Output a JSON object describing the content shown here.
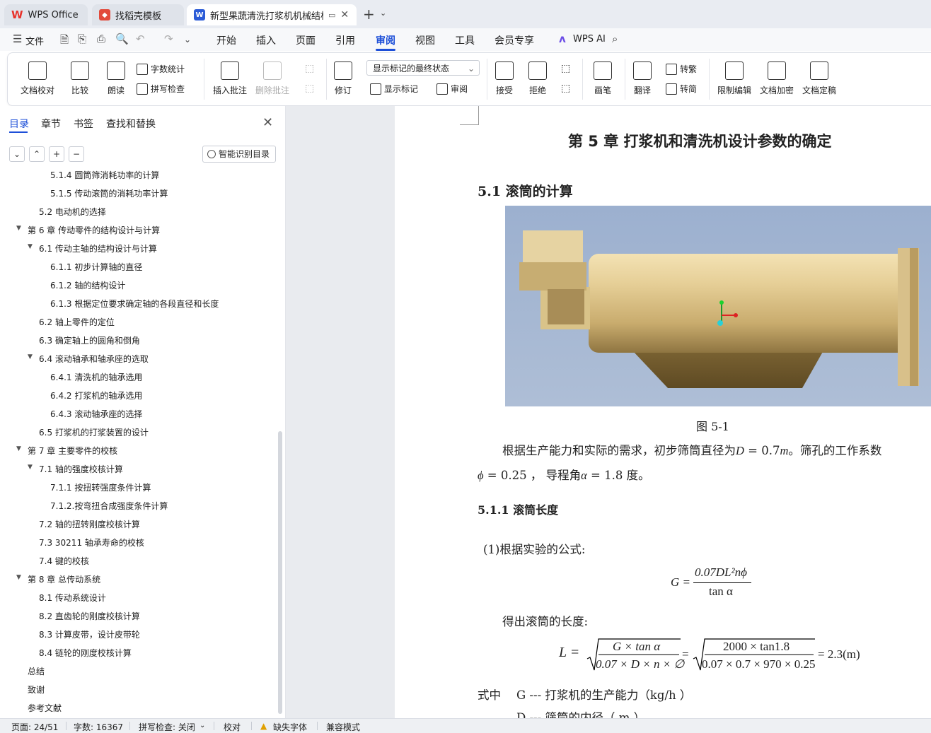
{
  "tabs": [
    {
      "label": "WPS Office",
      "logo": "W"
    },
    {
      "label": "找稻壳模板",
      "logo": "D"
    },
    {
      "label": "新型果蔬清洗打浆机机械结构设",
      "logo": "W"
    }
  ],
  "menu": {
    "file": "文件",
    "items": [
      "开始",
      "插入",
      "页面",
      "引用",
      "审阅",
      "视图",
      "工具",
      "会员专享"
    ],
    "selected": "审阅",
    "wps_ai": "WPS AI"
  },
  "ribbon": {
    "doc_check": "文档校对",
    "compare": "比较",
    "read_aloud": "朗读",
    "word_count": "字数统计",
    "spell_check": "拼写检查",
    "insert_comment": "插入批注",
    "delete_comment": "删除批注",
    "revise": "修订",
    "markup_state": "显示标记的最终状态",
    "show_markup": "显示标记",
    "review_pane": "审阅",
    "accept": "接受",
    "reject": "拒绝",
    "pen": "画笔",
    "translate": "翻译",
    "to_traditional": "转繁",
    "to_simplified": "转简",
    "restrict_edit": "限制编辑",
    "encrypt": "文档加密",
    "finalize": "文档定稿"
  },
  "panel": {
    "tabs": [
      "目录",
      "章节",
      "书签",
      "查找和替换"
    ],
    "smart_toc": "智能识别目录",
    "toc": [
      {
        "text": "5.1.4 圆筒筛消耗功率的计算",
        "level": 3,
        "arrow": false
      },
      {
        "text": "5.1.5 传动滚筒的消耗功率计算",
        "level": 3,
        "arrow": false
      },
      {
        "text": "5.2 电动机的选择",
        "level": 2,
        "arrow": false
      },
      {
        "text": "第 6 章  传动零件的结构设计与计算",
        "level": 1,
        "arrow": true
      },
      {
        "text": "6.1 传动主轴的结构设计与计算",
        "level": 2,
        "arrow": true
      },
      {
        "text": "6.1.1 初步计算轴的直径",
        "level": 3,
        "arrow": false
      },
      {
        "text": "6.1.2 轴的结构设计",
        "level": 3,
        "arrow": false
      },
      {
        "text": "6.1.3  根据定位要求确定轴的各段直径和长度",
        "level": 3,
        "arrow": false
      },
      {
        "text": "6.2 轴上零件的定位",
        "level": 2,
        "arrow": false
      },
      {
        "text": "6.3 确定轴上的圆角和倒角",
        "level": 2,
        "arrow": false
      },
      {
        "text": "6.4 滚动轴承和轴承座的选取",
        "level": 2,
        "arrow": true
      },
      {
        "text": "6.4.1 清洗机的轴承选用",
        "level": 3,
        "arrow": false
      },
      {
        "text": "6.4.2 打浆机的轴承选用",
        "level": 3,
        "arrow": false
      },
      {
        "text": "6.4.3 滚动轴承座的选择",
        "level": 3,
        "arrow": false
      },
      {
        "text": "6.5 打浆机的打浆装置的设计",
        "level": 2,
        "arrow": false
      },
      {
        "text": "第 7 章  主要零件的校核",
        "level": 1,
        "arrow": true
      },
      {
        "text": "7.1 轴的强度校核计算",
        "level": 2,
        "arrow": true
      },
      {
        "text": "7.1.1 按扭转强度条件计算",
        "level": 3,
        "arrow": false
      },
      {
        "text": "7.1.2.按弯扭合成强度条件计算",
        "level": 3,
        "arrow": false
      },
      {
        "text": "7.2 轴的扭转刚度校核计算",
        "level": 2,
        "arrow": false
      },
      {
        "text": "7.3 30211 轴承寿命的校核",
        "level": 2,
        "arrow": false
      },
      {
        "text": "7.4 键的校核",
        "level": 2,
        "arrow": false
      },
      {
        "text": "第 8 章  总传动系统",
        "level": 1,
        "arrow": true
      },
      {
        "text": "8.1 传动系统设计",
        "level": 2,
        "arrow": false
      },
      {
        "text": "8.2 直齿轮的刚度校核计算",
        "level": 2,
        "arrow": false
      },
      {
        "text": "8.3 计算皮带，设计皮带轮",
        "level": 2,
        "arrow": false
      },
      {
        "text": "8.4 链轮的刚度校核计算",
        "level": 2,
        "arrow": false
      },
      {
        "text": "总结",
        "level": 1,
        "arrow": false
      },
      {
        "text": "致谢",
        "level": 1,
        "arrow": false
      },
      {
        "text": "参考文献",
        "level": 1,
        "arrow": false
      }
    ]
  },
  "document": {
    "chapter_title": "第 5 章     打浆机和清洗机设计参数的确定",
    "section_title": "5.1 滚筒的计算",
    "figure_caption": "图 5-1",
    "para1_a": "根据生产能力和实际的需求，初步筛筒直径为",
    "para1_d": "D",
    "para1_eq": " = 0.7",
    "para1_m": "m",
    "para1_b": "。筛孔的工作系数",
    "para2_phi": "ϕ",
    "para2_a": " = 0.25 ，  导程角",
    "para2_alpha": "α",
    "para2_b": " = 1.8 度。",
    "subsection_title": "5.1.1 滚筒长度",
    "step1": "(1)根据实验的公式:",
    "formula1_lhs": "G =",
    "formula1_num": "0.07DL²nϕ",
    "formula1_den": "tan α",
    "step2": "得出滚筒的长度:",
    "formula2_lhs": "L =",
    "formula2_num1": "G × tan α",
    "formula2_den1": "0.07 × D × n × ∅",
    "formula2_num2": "2000 × tan1.8",
    "formula2_den2": "0.07 × 0.7 × 970 × 0.25",
    "formula2_result": "= 2.3(m)",
    "where_label": "式中",
    "var_g": "G ---  打浆机的生产能力（kg/h ）",
    "var_d": "D ---  筛筒的内径（ m ）"
  },
  "status": {
    "page": "页面: 24/51",
    "words": "字数: 16367",
    "spell": "拼写检查: 关闭",
    "proof": "校对",
    "missing_font": "缺失字体",
    "compat": "兼容模式"
  },
  "colors": {
    "accent": "#1d4fd8",
    "wps_red": "#e8322b",
    "docer_red": "#e24a3b",
    "writer_blue": "#2b5bd7"
  }
}
